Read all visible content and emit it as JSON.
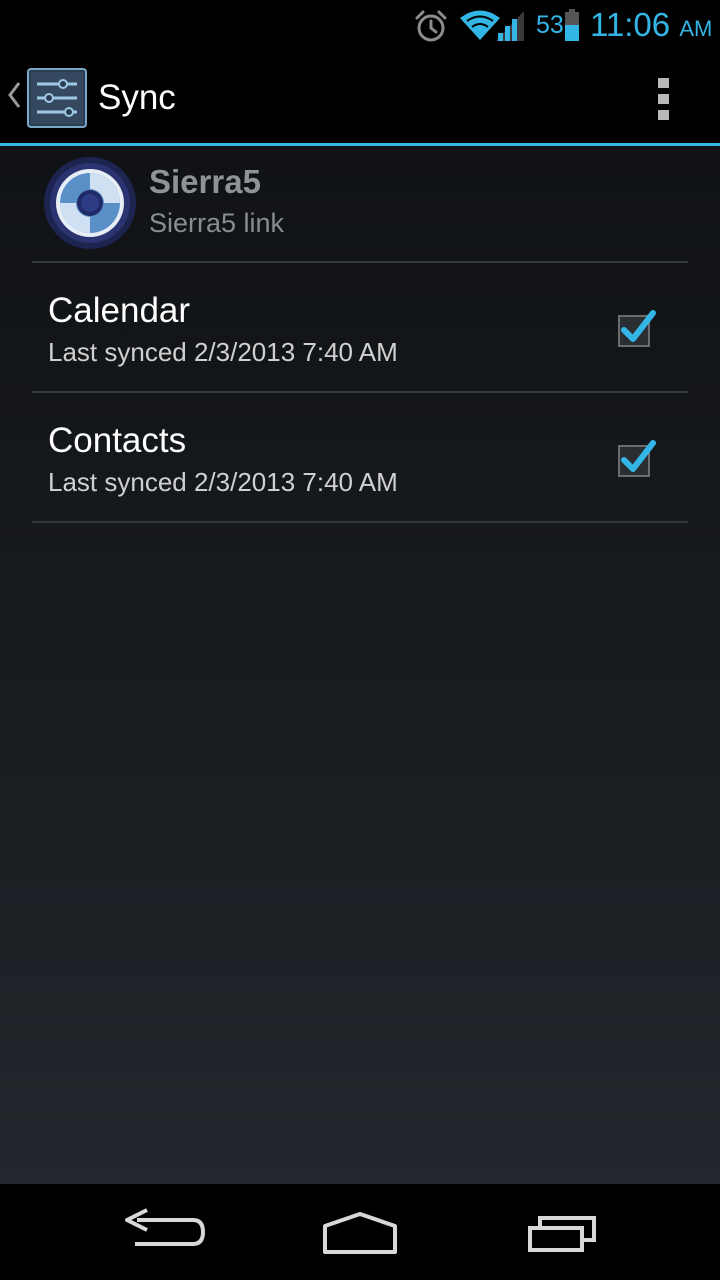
{
  "status_bar": {
    "battery_percent": "53",
    "time": "11:06",
    "ampm": "AM",
    "accent_color": "#33b5e5"
  },
  "action_bar": {
    "title": "Sync",
    "icons": [
      "up-indicator-icon",
      "settings-sliders-icon",
      "overflow-menu-icon"
    ]
  },
  "account": {
    "name": "Sierra5",
    "type": "Sierra5 link"
  },
  "sync_items": [
    {
      "title": "Calendar",
      "subtitle": "Last synced 2/3/2013 7:40 AM",
      "checked": true
    },
    {
      "title": "Contacts",
      "subtitle": "Last synced 2/3/2013 7:40 AM",
      "checked": true
    }
  ],
  "nav_bar": {
    "buttons": [
      "back",
      "home",
      "recents"
    ]
  }
}
